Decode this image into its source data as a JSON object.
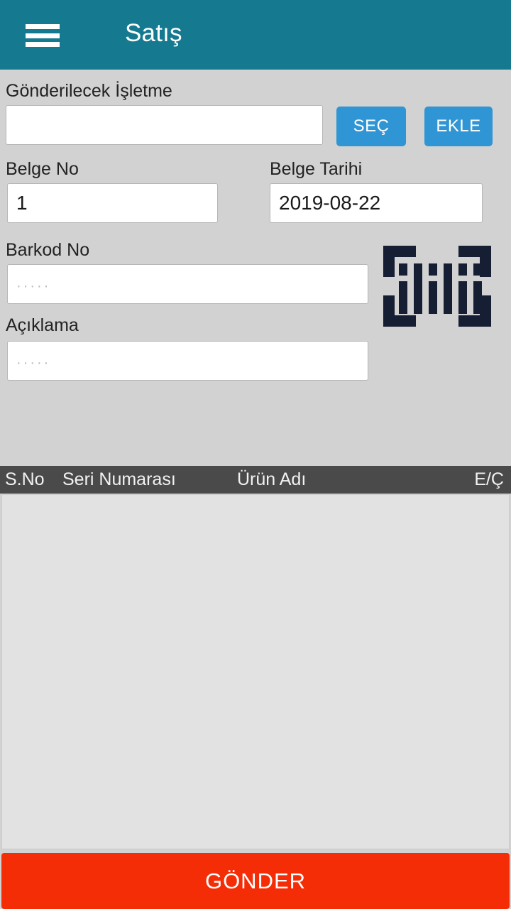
{
  "appbar": {
    "title": "Satış",
    "menu_icon": "hamburger-menu-icon",
    "background_color": "#15798F"
  },
  "form": {
    "recipient": {
      "label": "Gönderilecek İşletme",
      "value": "",
      "placeholder": ""
    },
    "select_button": {
      "label": "SEÇ",
      "color": "#2F95D4"
    },
    "add_button": {
      "label": "EKLE",
      "color": "#2F95D4"
    },
    "document_no": {
      "label": "Belge No",
      "value": "1",
      "placeholder": ""
    },
    "document_date": {
      "label": "Belge Tarihi",
      "value": "2019-08-22",
      "placeholder": ""
    },
    "barcode_no": {
      "label": "Barkod No",
      "value": "",
      "placeholder": "·····"
    },
    "description": {
      "label": "Açıklama",
      "value": "",
      "placeholder": "·····"
    },
    "scan_icon": {
      "name": "barcode-scan-icon",
      "color": "#161E33"
    }
  },
  "table": {
    "columns": [
      "S.No",
      "Seri Numarası",
      "Ürün Adı",
      "E/Ç"
    ],
    "rows": [],
    "header_background": "#4A4A4A",
    "body_background": "#E2E2E2"
  },
  "submit": {
    "label": "GÖNDER",
    "color": "#F42D07"
  }
}
